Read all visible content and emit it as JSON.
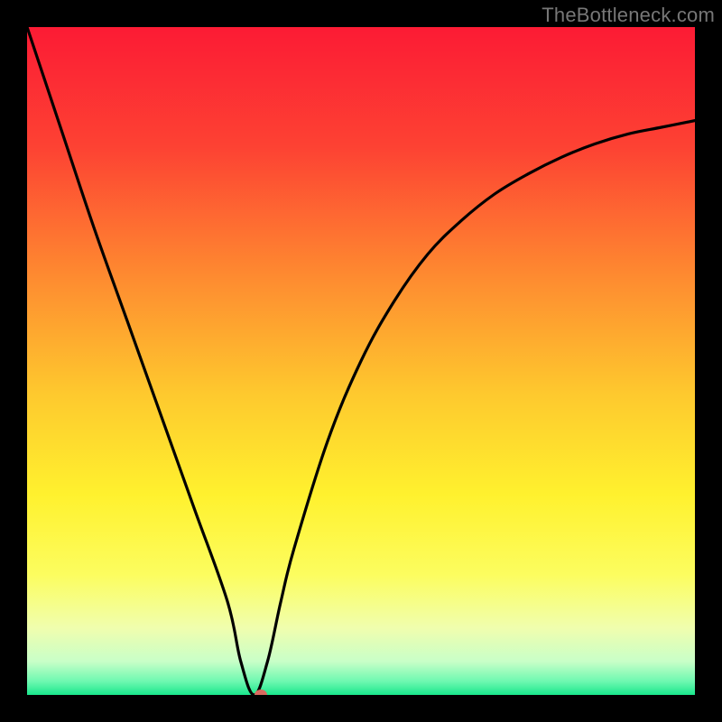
{
  "watermark": "TheBottleneck.com",
  "colors": {
    "frame": "#000000",
    "curve": "#000000",
    "dot": "#d96a5f",
    "gradient_stops": [
      {
        "pct": 0,
        "color": "#fc1b34"
      },
      {
        "pct": 18,
        "color": "#fd4233"
      },
      {
        "pct": 38,
        "color": "#fe8d30"
      },
      {
        "pct": 55,
        "color": "#fec92e"
      },
      {
        "pct": 70,
        "color": "#fff12e"
      },
      {
        "pct": 82,
        "color": "#fcfd5f"
      },
      {
        "pct": 90,
        "color": "#f0feae"
      },
      {
        "pct": 95,
        "color": "#c8ffc8"
      },
      {
        "pct": 98,
        "color": "#6df8b0"
      },
      {
        "pct": 100,
        "color": "#19e78c"
      }
    ]
  },
  "chart_data": {
    "type": "line",
    "title": "",
    "xlabel": "",
    "ylabel": "",
    "xlim": [
      0,
      100
    ],
    "ylim": [
      0,
      100
    ],
    "grid": false,
    "legend": false,
    "curve_minimum": {
      "x": 34,
      "y": 0
    },
    "dot": {
      "x": 35,
      "y": 0
    },
    "series": [
      {
        "name": "bottleneck-curve",
        "x": [
          0,
          5,
          10,
          15,
          20,
          25,
          30,
          32,
          34,
          36,
          38,
          40,
          45,
          50,
          55,
          60,
          65,
          70,
          75,
          80,
          85,
          90,
          95,
          100
        ],
        "y": [
          100,
          85,
          70,
          56,
          42,
          28,
          14,
          5,
          0,
          5,
          14,
          22,
          38,
          50,
          59,
          66,
          71,
          75,
          78,
          80.5,
          82.5,
          84,
          85,
          86
        ]
      }
    ]
  }
}
